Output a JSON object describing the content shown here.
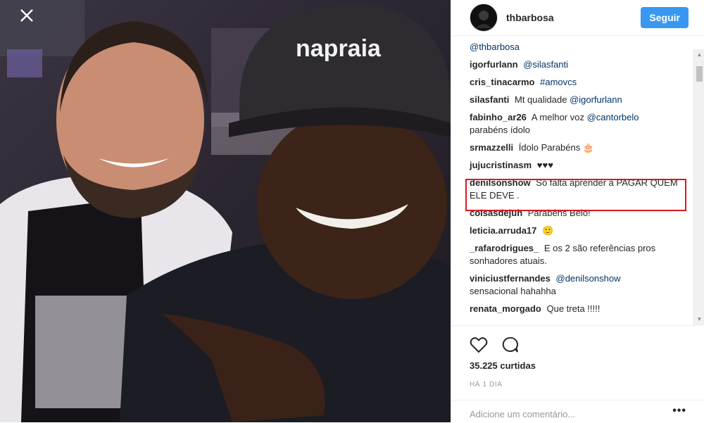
{
  "post": {
    "username": "thbarbosa",
    "follow_label": "Seguir",
    "cap_text": "napraia",
    "likes": "35.225 curtidas",
    "time": "HÁ 1 DIA",
    "add_comment_placeholder": "Adicione um comentário...",
    "more_label": "•••"
  },
  "comments": [
    {
      "user": "",
      "text": "",
      "mention": "@thbarbosa"
    },
    {
      "user": "igorfurlann",
      "text": "",
      "mention": "@silasfanti"
    },
    {
      "user": "cris_tinacarmo",
      "text": "",
      "mention": "#amovcs"
    },
    {
      "user": "silasfanti",
      "text": "Mt qualidade",
      "mention": "@igorfurlann"
    },
    {
      "user": "fabinho_ar26",
      "text": "A melhor voz",
      "mention": "@cantorbelo",
      "text2": "parabéns ídolo"
    },
    {
      "user": "srmazzelli",
      "text": "Ídolo Parabéns 🎂",
      "mention": ""
    },
    {
      "user": "jujucristinasm",
      "text": "♥♥♥",
      "mention": ""
    },
    {
      "user": "denilsonshow",
      "text": "Só falta aprender a PAGAR QUEM ELE DEVE .",
      "mention": ""
    },
    {
      "user": "coisasdejuh",
      "text": "Parabéns Belo!",
      "mention": ""
    },
    {
      "user": "leticia.arruda17",
      "text": "🙂",
      "mention": ""
    },
    {
      "user": "_rafarodrigues_",
      "text": "E os 2 são referências pros sonhadores atuais.",
      "mention": ""
    },
    {
      "user": "viniciustfernandes",
      "text": "",
      "mention": "@denilsonshow",
      "text2": "sensacional hahahha"
    },
    {
      "user": "renata_morgado",
      "text": "Que treta !!!!!",
      "mention": ""
    }
  ],
  "colors": {
    "accent": "#3897f0",
    "highlight": "#d9191f",
    "mention": "#003569"
  },
  "icons": {
    "close": "close-icon",
    "like": "heart-icon",
    "comment": "comment-icon"
  }
}
